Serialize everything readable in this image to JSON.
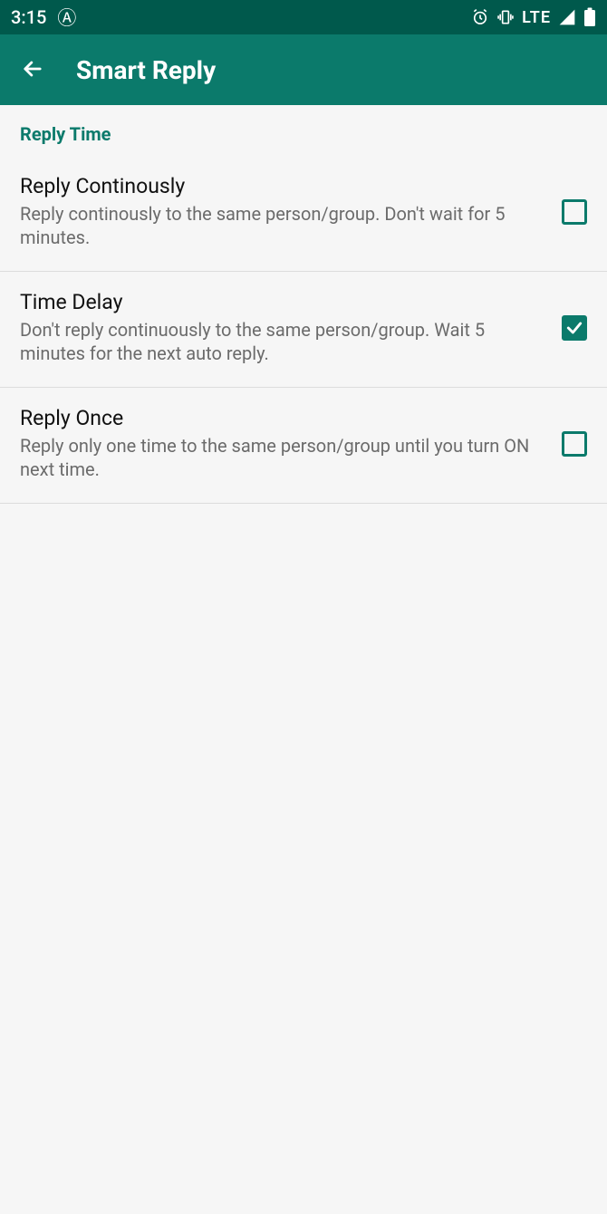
{
  "statusbar": {
    "time": "3:15",
    "a_icon": "Ⓐ",
    "lte": "LTE"
  },
  "appbar": {
    "title": "Smart Reply"
  },
  "section": {
    "header": "Reply Time",
    "items": [
      {
        "title": "Reply Continously",
        "desc": "Reply continously to the same person/group. Don't wait for 5 minutes.",
        "checked": false
      },
      {
        "title": "Time Delay",
        "desc": "Don't reply continuously to the same person/group. Wait 5 minutes for the next auto reply.",
        "checked": true
      },
      {
        "title": "Reply Once",
        "desc": "Reply only one time to the same person/group until you turn ON next time.",
        "checked": false
      }
    ]
  }
}
